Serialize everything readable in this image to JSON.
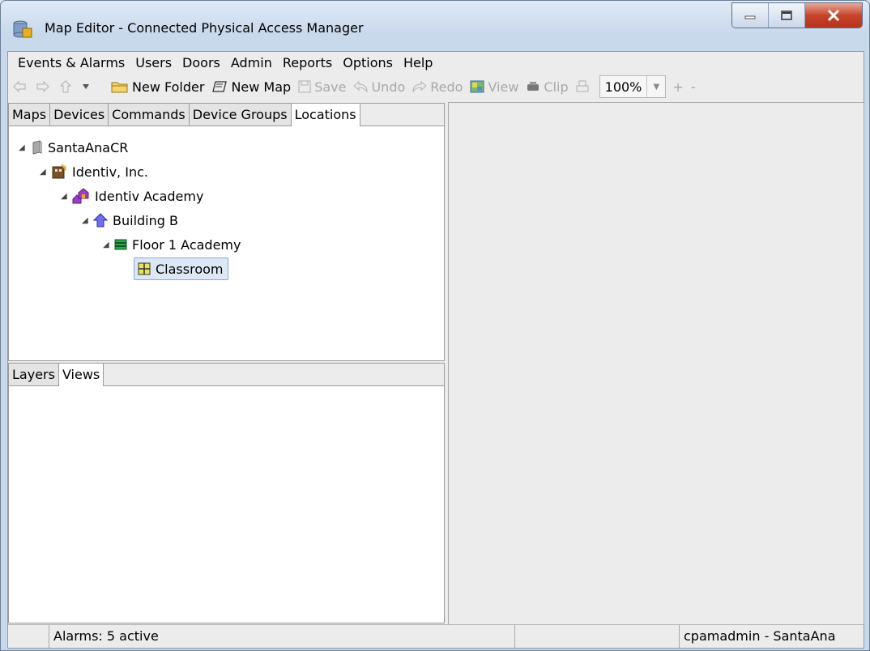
{
  "window": {
    "title": "Map Editor - Connected Physical Access Manager"
  },
  "menubar": {
    "items": [
      "Events & Alarms",
      "Users",
      "Doors",
      "Admin",
      "Reports",
      "Options",
      "Help"
    ]
  },
  "toolbar": {
    "new_folder": "New Folder",
    "new_map": "New Map",
    "save": "Save",
    "undo": "Undo",
    "redo": "Redo",
    "view": "View",
    "clip": "Clip",
    "zoom": "100%",
    "zoom_in": "+",
    "zoom_out": "-"
  },
  "top_tabs": [
    "Maps",
    "Devices",
    "Commands",
    "Device Groups",
    "Locations"
  ],
  "active_top_tab": "Locations",
  "tree": [
    {
      "label": "SantaAnaCR",
      "icon": "server-icon"
    },
    {
      "label": "Identiv, Inc.",
      "icon": "company-icon"
    },
    {
      "label": "Identiv Academy",
      "icon": "campus-icon"
    },
    {
      "label": "Building B",
      "icon": "building-icon"
    },
    {
      "label": "Floor 1 Academy",
      "icon": "floor-icon"
    },
    {
      "label": "Classroom",
      "icon": "room-icon"
    }
  ],
  "bottom_tabs": [
    "Layers",
    "Views"
  ],
  "active_bottom_tab": "Views",
  "statusbar": {
    "alarms": "Alarms: 5 active",
    "user": "cpamadmin - SantaAna"
  },
  "colors": {
    "close_button": "#c7442a",
    "selection": "#dde8f6"
  }
}
